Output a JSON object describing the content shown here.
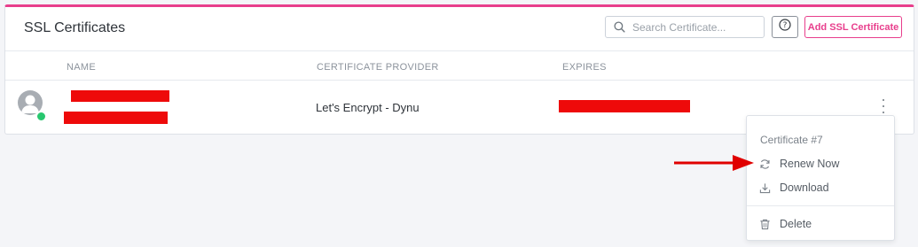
{
  "card": {
    "title": "SSL Certificates",
    "search": {
      "placeholder": "Search Certificate..."
    },
    "add_button_label": "Add SSL Certificate",
    "help_icon": "question-circle-icon"
  },
  "table": {
    "columns": [
      "NAME",
      "CERTIFICATE PROVIDER",
      "EXPIRES"
    ],
    "rows": [
      {
        "name": "",
        "provider": "Let's Encrypt - Dynu",
        "expires": "",
        "status": "online"
      }
    ]
  },
  "dropdown_menu": {
    "header": "Certificate #7",
    "items": [
      {
        "label": "Renew Now",
        "icon": "refresh-icon"
      },
      {
        "label": "Download",
        "icon": "download-icon"
      },
      {
        "label": "Delete",
        "icon": "trash-icon"
      }
    ]
  },
  "colors": {
    "accent": "#e83e8c",
    "status_online": "#28c76f",
    "redaction": "#ee0a0a",
    "annotation_arrow": "#e00000"
  }
}
